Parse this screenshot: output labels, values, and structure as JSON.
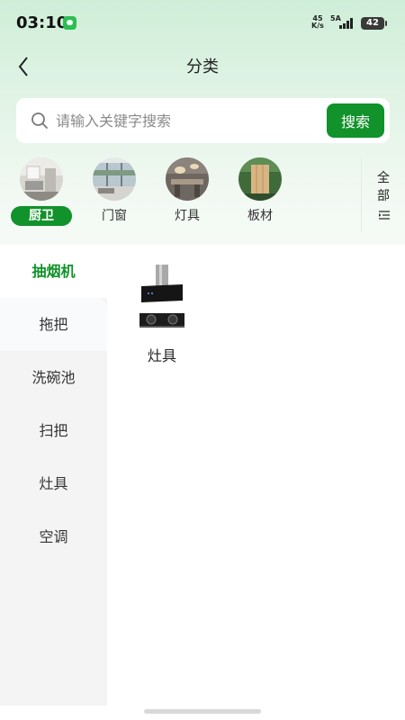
{
  "status_bar": {
    "time": "03:10",
    "net_speed_value": "45",
    "net_speed_unit": "K/s",
    "sim": "5A",
    "battery": "42"
  },
  "nav": {
    "title": "分类"
  },
  "search": {
    "placeholder": "请输入关键字搜索",
    "value": "",
    "button_label": "搜索"
  },
  "categories": [
    {
      "label": "厨卫",
      "active": true
    },
    {
      "label": "门窗",
      "active": false
    },
    {
      "label": "灯具",
      "active": false
    },
    {
      "label": "板材",
      "active": false
    }
  ],
  "all_button": {
    "label": "全部"
  },
  "sidebar": {
    "items": [
      {
        "label": "抽烟机",
        "active": true
      },
      {
        "label": "拖把",
        "active": false
      },
      {
        "label": "洗碗池",
        "active": false
      },
      {
        "label": "扫把",
        "active": false
      },
      {
        "label": "灶具",
        "active": false
      },
      {
        "label": "空调",
        "active": false
      }
    ]
  },
  "products": [
    {
      "label": "灶具"
    }
  ],
  "colors": {
    "accent": "#11922a",
    "header_gradient_top": "#cfeed8",
    "sidebar_bg": "#f4f4f4"
  }
}
